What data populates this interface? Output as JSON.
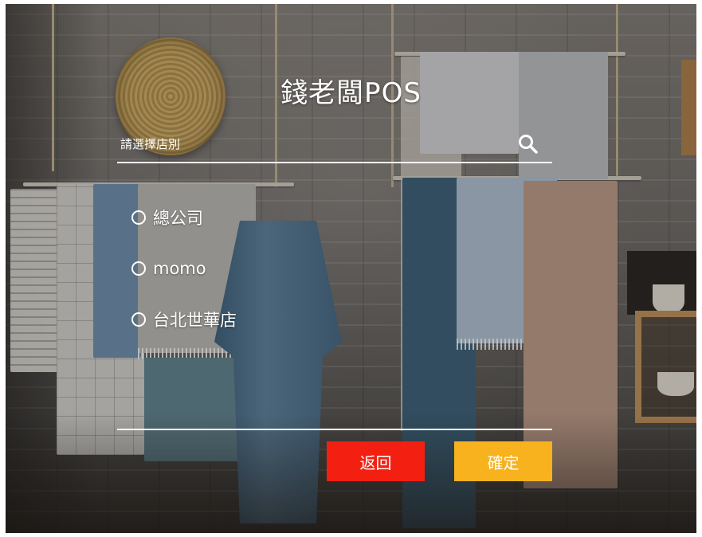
{
  "app": {
    "title": "錢老闆POS"
  },
  "search": {
    "placeholder": "請選擇店別",
    "value": "",
    "icon": "search-icon"
  },
  "stores": [
    {
      "label": "總公司",
      "selected": false
    },
    {
      "label": "momo",
      "selected": false
    },
    {
      "label": "台北世華店",
      "selected": false
    }
  ],
  "actions": {
    "back_label": "返回",
    "confirm_label": "確定"
  },
  "colors": {
    "back_button": "#f32012",
    "confirm_button": "#f7b21e",
    "text": "#ffffff"
  }
}
